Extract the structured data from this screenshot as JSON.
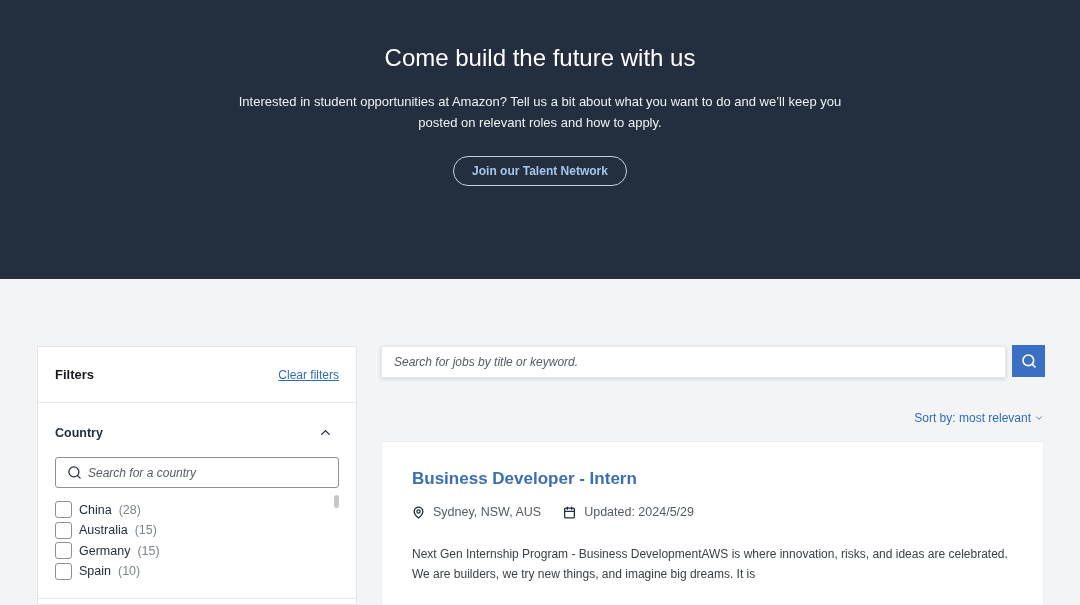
{
  "hero": {
    "title": "Come build the future with us",
    "description": "Interested in student opportunities at Amazon? Tell us a bit about what you want to do and we’ll keep you posted on relevant roles and how to apply.",
    "button": "Join our Talent Network"
  },
  "filters": {
    "title": "Filters",
    "clear_link": "Clear filters",
    "sections": [
      {
        "title": "Country",
        "expanded": true,
        "search": {
          "placeholder": "Search for a country"
        },
        "options": [
          {
            "label": "China",
            "count": "(28)",
            "checked": false
          },
          {
            "label": "Australia",
            "count": "(15)",
            "checked": false
          },
          {
            "label": "Germany",
            "count": "(15)",
            "checked": false
          },
          {
            "label": "Spain",
            "count": "(10)",
            "checked": false
          }
        ]
      }
    ]
  },
  "job_search": {
    "placeholder": "Search for jobs by title or keyword."
  },
  "sort": {
    "label": "Sort by: most relevant"
  },
  "jobs": [
    {
      "title": "Business Developer - Intern",
      "location": "Sydney, NSW, AUS",
      "updated": "Updated: 2024/5/29",
      "description": "Next Gen Internship Program - Business DevelopmentAWS is where innovation, risks, and ideas are celebrated. We are builders, we try new things, and imagine big dreams. It is"
    }
  ]
}
